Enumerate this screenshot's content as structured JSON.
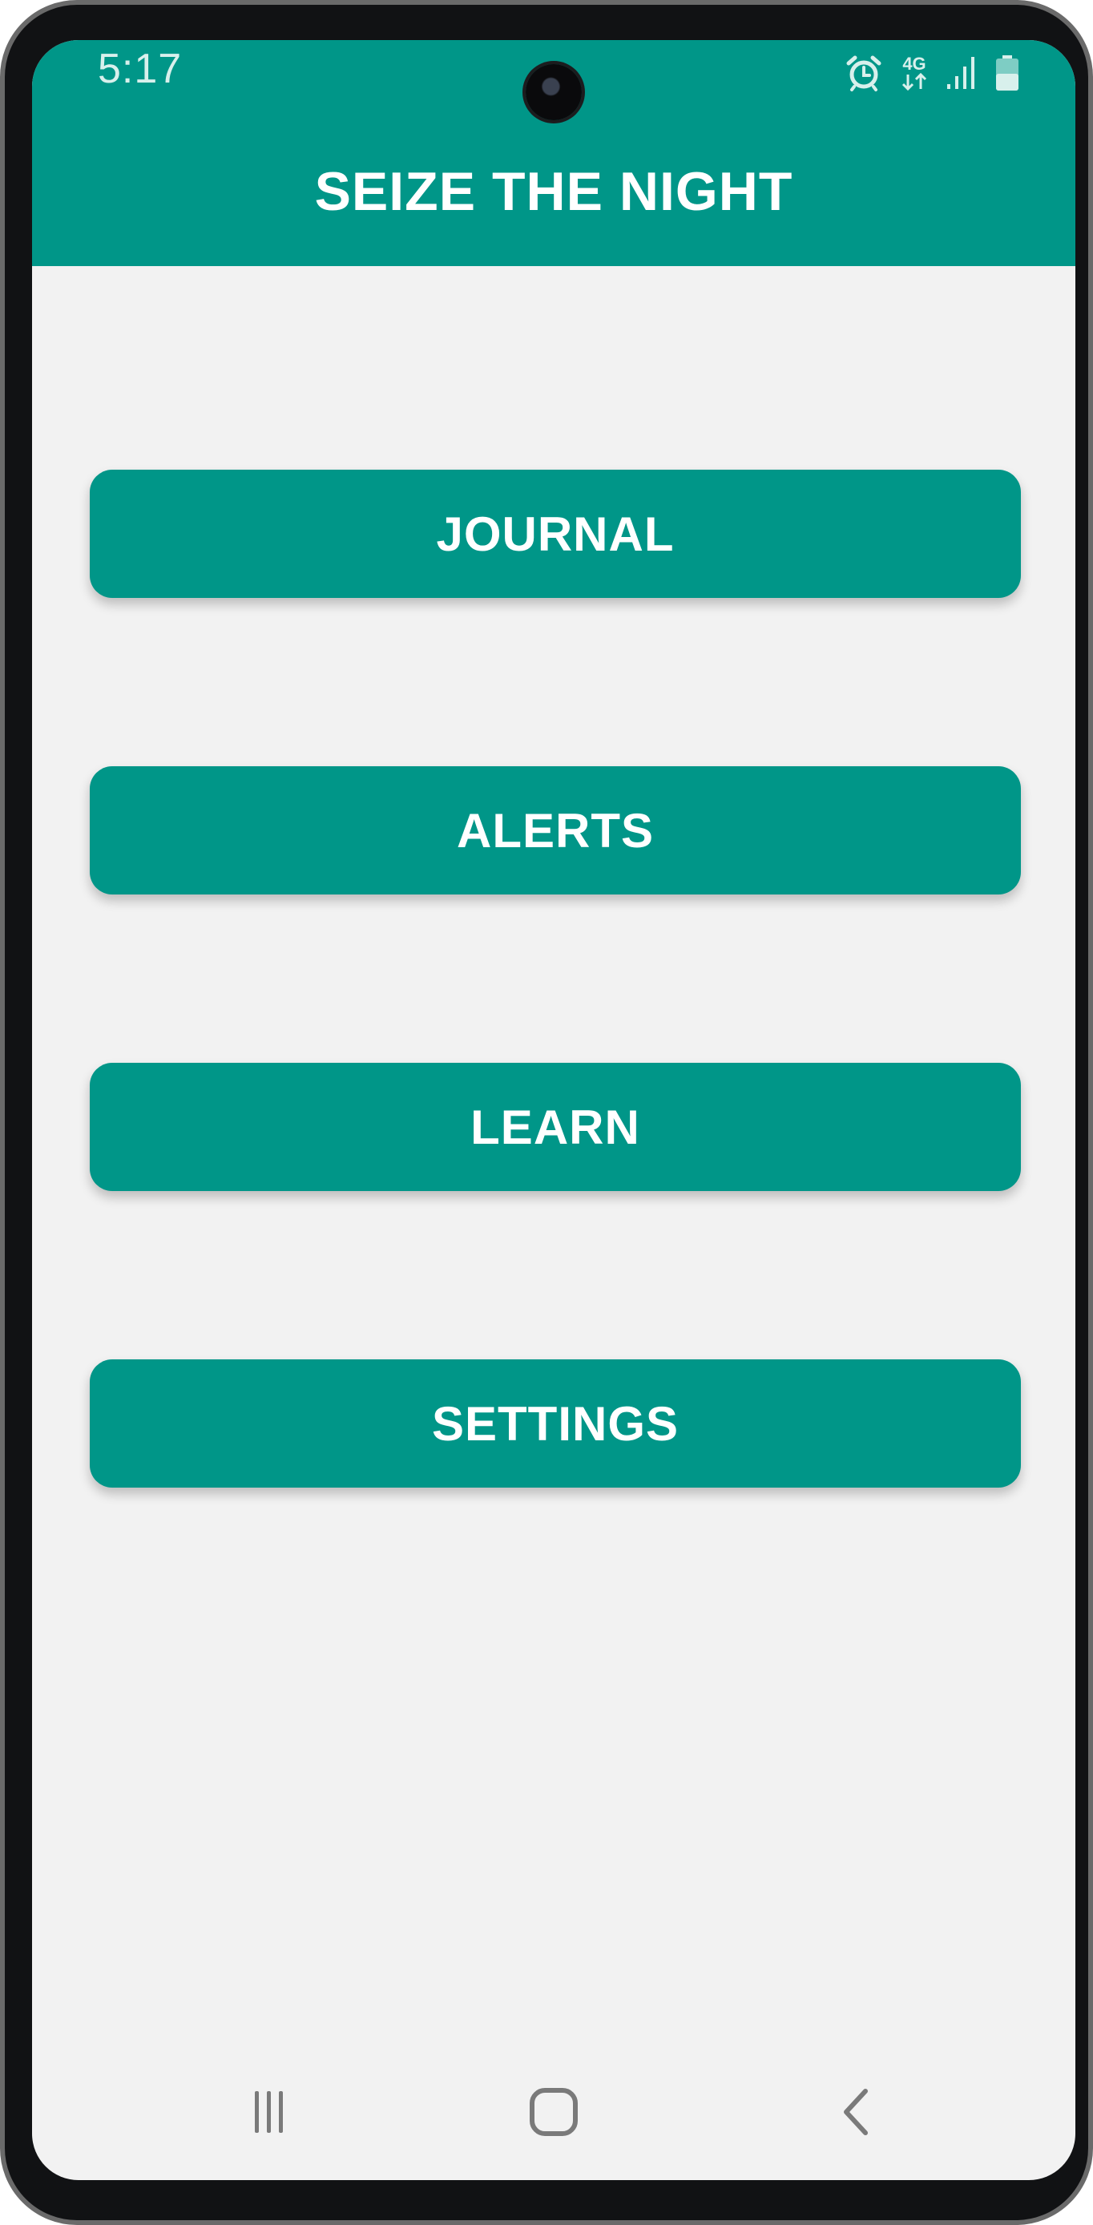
{
  "status_bar": {
    "time": "5:17",
    "network_label": "4G",
    "icons": [
      "alarm-icon",
      "network-4g-icon",
      "signal-icon",
      "battery-icon"
    ]
  },
  "app_bar": {
    "title": "SEIZE THE NIGHT"
  },
  "menu": {
    "buttons": [
      {
        "label": "JOURNAL"
      },
      {
        "label": "ALERTS"
      },
      {
        "label": "LEARN"
      },
      {
        "label": "SETTINGS"
      }
    ]
  },
  "nav_bar": {
    "icons": [
      "recent-apps-icon",
      "home-icon",
      "back-icon"
    ]
  },
  "colors": {
    "primary": "#009688",
    "background": "#f2f2f2",
    "on_primary": "#ffffff"
  }
}
